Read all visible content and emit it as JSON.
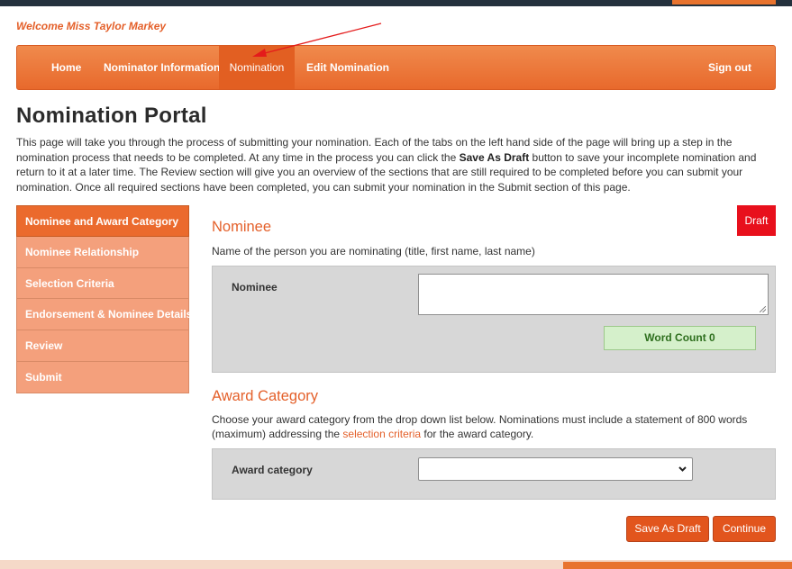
{
  "header": {
    "welcome": "Welcome Miss Taylor Markey",
    "accent_color": "#e8732e"
  },
  "nav": {
    "home": "Home",
    "nominator_information": "Nominator Information",
    "nomination": "Nomination",
    "edit_nomination": "Edit Nomination",
    "sign_out": "Sign out",
    "active": "Nomination"
  },
  "page": {
    "title": "Nomination Portal",
    "intro_part1": "This page will take you through the process of submitting your nomination.  Each of the tabs on the left hand side of the page will bring up a step in the nomination process that needs to be completed.  At any time in the process you can click the ",
    "intro_bold": "Save As Draft",
    "intro_part2": " button to save your incomplete nomination and return to it at a later time.  The Review section will give you an overview of the sections that are still required to be completed before you can submit your nomination.  Once all required sections have been completed, you can submit your nomination in the Submit section of this page."
  },
  "sidebar": {
    "items": [
      {
        "label": "Nominee and Award Category",
        "active": true
      },
      {
        "label": "Nominee Relationship",
        "active": false
      },
      {
        "label": "Selection Criteria",
        "active": false
      },
      {
        "label": "Endorsement & Nominee Details",
        "active": false
      },
      {
        "label": "Review",
        "active": false
      },
      {
        "label": "Submit",
        "active": false
      }
    ]
  },
  "status": {
    "badge": "Draft",
    "color": "#e8101c"
  },
  "nominee_section": {
    "title": "Nominee",
    "description": "Name of the person you are nominating (title, first name, last name)",
    "field_label": "Nominee",
    "value": "",
    "word_count_label": "Word Count 0"
  },
  "award_section": {
    "title": "Award Category",
    "description_part1": "Choose your award category from the drop down list below. Nominations must include a statement of 800 words (maximum) addressing the ",
    "link_text": "selection criteria",
    "description_part2": " for the award category.",
    "field_label": "Award category",
    "selected_value": ""
  },
  "actions": {
    "save_draft": "Save As Draft",
    "continue": "Continue"
  },
  "icons": {
    "select_chevron": "chevron-down-icon",
    "annotation_arrow": "red-arrow-annotation"
  }
}
